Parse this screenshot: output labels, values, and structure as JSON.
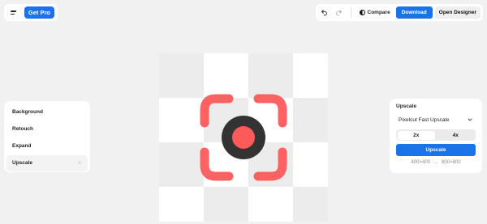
{
  "header": {
    "menu_icon": "hamburger-menu-icon",
    "get_pro_label": "Get Pro"
  },
  "toolbar": {
    "undo_icon": "undo-icon",
    "redo_icon": "redo-icon",
    "compare_label": "Compare",
    "compare_icon": "half-circle-contrast-icon",
    "download_label": "Download",
    "open_designer_label": "Open Designer"
  },
  "tools": {
    "items": [
      {
        "label": "Background"
      },
      {
        "label": "Retouch"
      },
      {
        "label": "Expand"
      },
      {
        "label": "Upscale",
        "active": true,
        "close": "×"
      }
    ]
  },
  "upscale_panel": {
    "title": "Upscale",
    "model_value": "Pixelcut Fast Upscale",
    "scale_options": [
      "2x",
      "4x"
    ],
    "selected_scale": "2x",
    "button_label": "Upscale",
    "from_size": "400×400",
    "arrow": "→",
    "to_size": "800×800"
  },
  "colors": {
    "accent": "#1a73e8",
    "record_red": "#ff5a5a",
    "record_dark": "#333333",
    "checker_gray": "#ececec"
  }
}
